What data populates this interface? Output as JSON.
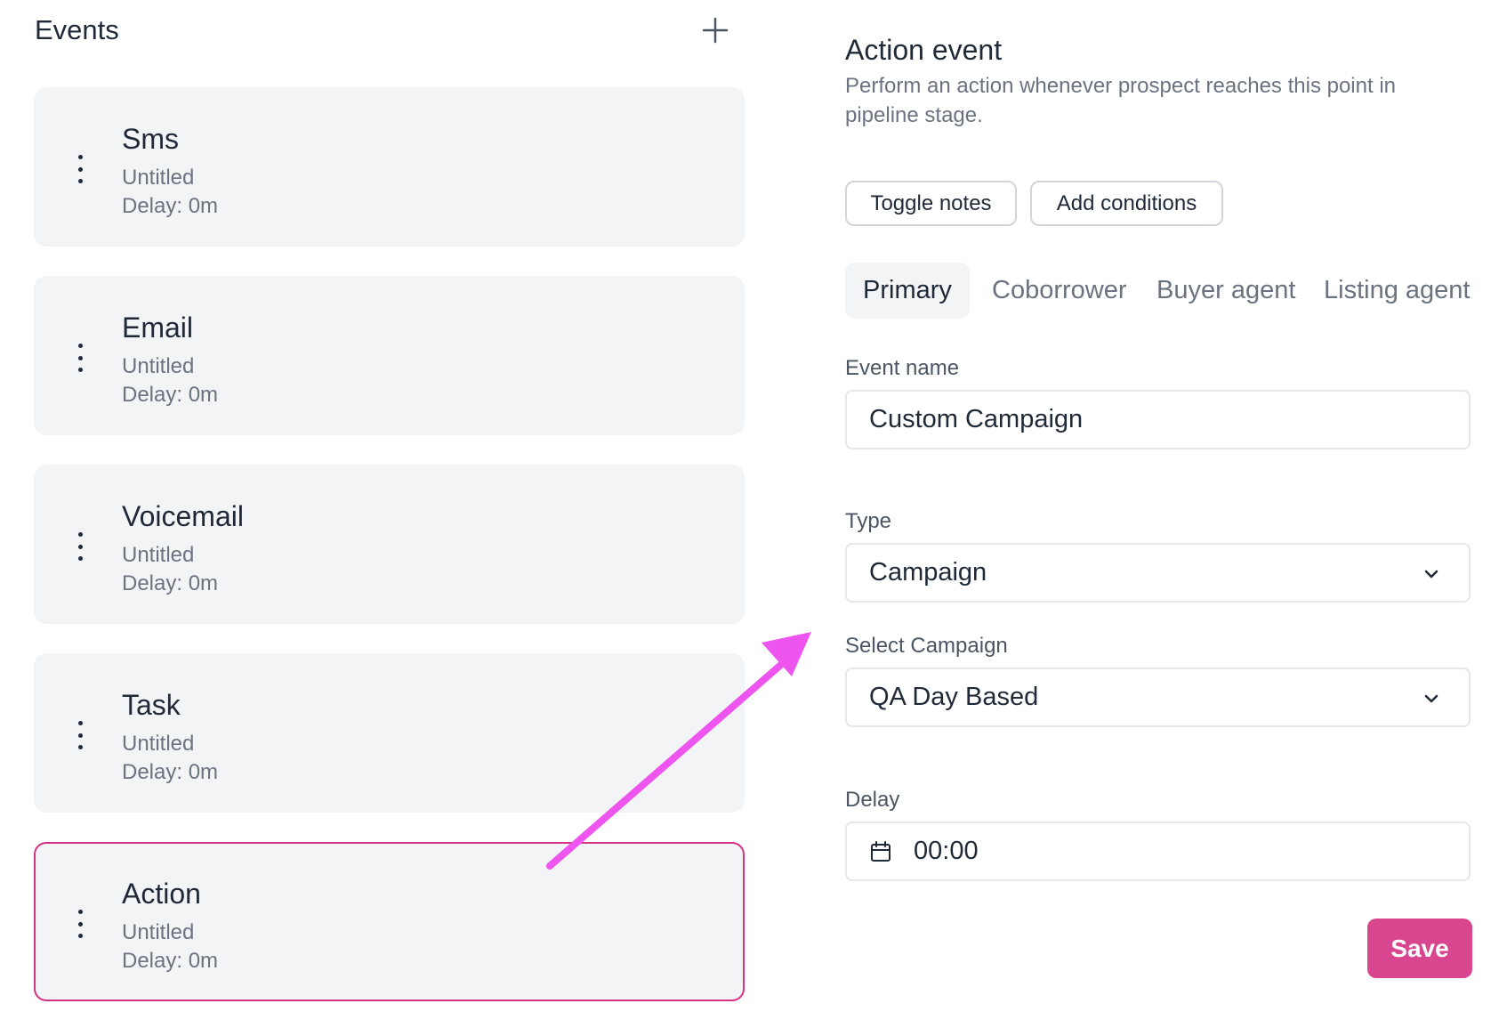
{
  "events_panel": {
    "title": "Events",
    "add_icon": "plus-icon",
    "items": [
      {
        "title": "Sms",
        "subtitle": "Untitled",
        "delay": "Delay: 0m",
        "selected": false
      },
      {
        "title": "Email",
        "subtitle": "Untitled",
        "delay": "Delay: 0m",
        "selected": false
      },
      {
        "title": "Voicemail",
        "subtitle": "Untitled",
        "delay": "Delay: 0m",
        "selected": false
      },
      {
        "title": "Task",
        "subtitle": "Untitled",
        "delay": "Delay: 0m",
        "selected": false
      },
      {
        "title": "Action",
        "subtitle": "Untitled",
        "delay": "Delay: 0m",
        "selected": true
      }
    ]
  },
  "action_event": {
    "title": "Action event",
    "description": "Perform an action whenever prospect reaches this point in pipeline stage.",
    "buttons": {
      "toggle_notes": "Toggle notes",
      "add_conditions": "Add conditions"
    },
    "tabs": [
      {
        "label": "Primary",
        "active": true
      },
      {
        "label": "Coborrower",
        "active": false
      },
      {
        "label": "Buyer agent",
        "active": false
      },
      {
        "label": "Listing agent",
        "active": false
      }
    ],
    "event_name": {
      "label": "Event name",
      "value": "Custom Campaign"
    },
    "type": {
      "label": "Type",
      "value": "Campaign"
    },
    "select_campaign": {
      "label": "Select Campaign",
      "value": "QA Day Based"
    },
    "delay": {
      "label": "Delay",
      "value": "00:00",
      "icon": "calendar-icon"
    },
    "save_label": "Save"
  },
  "colors": {
    "accent": "#d94690",
    "selected_border": "#d63384",
    "annotation_arrow": "#ee55ee",
    "card_bg": "#f3f4f6"
  }
}
